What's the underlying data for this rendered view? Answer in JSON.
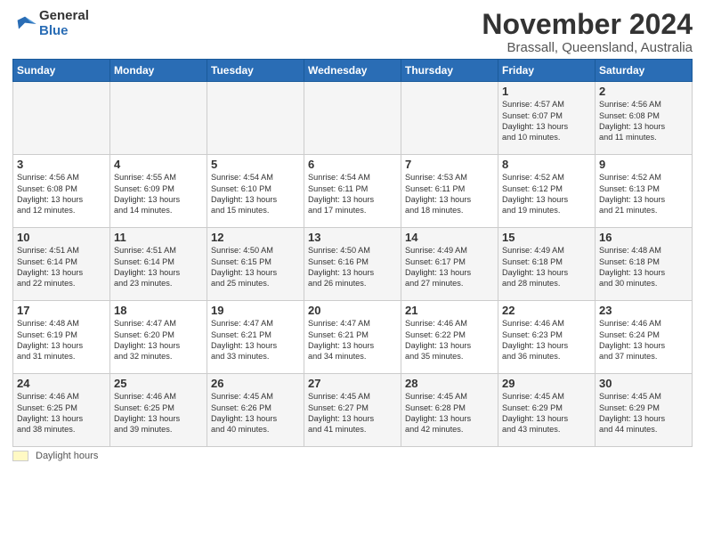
{
  "header": {
    "logo_general": "General",
    "logo_blue": "Blue",
    "month_title": "November 2024",
    "subtitle": "Brassall, Queensland, Australia"
  },
  "legend": {
    "label": "Daylight hours"
  },
  "days_of_week": [
    "Sunday",
    "Monday",
    "Tuesday",
    "Wednesday",
    "Thursday",
    "Friday",
    "Saturday"
  ],
  "weeks": [
    [
      {
        "day": "",
        "info": ""
      },
      {
        "day": "",
        "info": ""
      },
      {
        "day": "",
        "info": ""
      },
      {
        "day": "",
        "info": ""
      },
      {
        "day": "",
        "info": ""
      },
      {
        "day": "1",
        "info": "Sunrise: 4:57 AM\nSunset: 6:07 PM\nDaylight: 13 hours\nand 10 minutes."
      },
      {
        "day": "2",
        "info": "Sunrise: 4:56 AM\nSunset: 6:08 PM\nDaylight: 13 hours\nand 11 minutes."
      }
    ],
    [
      {
        "day": "3",
        "info": "Sunrise: 4:56 AM\nSunset: 6:08 PM\nDaylight: 13 hours\nand 12 minutes."
      },
      {
        "day": "4",
        "info": "Sunrise: 4:55 AM\nSunset: 6:09 PM\nDaylight: 13 hours\nand 14 minutes."
      },
      {
        "day": "5",
        "info": "Sunrise: 4:54 AM\nSunset: 6:10 PM\nDaylight: 13 hours\nand 15 minutes."
      },
      {
        "day": "6",
        "info": "Sunrise: 4:54 AM\nSunset: 6:11 PM\nDaylight: 13 hours\nand 17 minutes."
      },
      {
        "day": "7",
        "info": "Sunrise: 4:53 AM\nSunset: 6:11 PM\nDaylight: 13 hours\nand 18 minutes."
      },
      {
        "day": "8",
        "info": "Sunrise: 4:52 AM\nSunset: 6:12 PM\nDaylight: 13 hours\nand 19 minutes."
      },
      {
        "day": "9",
        "info": "Sunrise: 4:52 AM\nSunset: 6:13 PM\nDaylight: 13 hours\nand 21 minutes."
      }
    ],
    [
      {
        "day": "10",
        "info": "Sunrise: 4:51 AM\nSunset: 6:14 PM\nDaylight: 13 hours\nand 22 minutes."
      },
      {
        "day": "11",
        "info": "Sunrise: 4:51 AM\nSunset: 6:14 PM\nDaylight: 13 hours\nand 23 minutes."
      },
      {
        "day": "12",
        "info": "Sunrise: 4:50 AM\nSunset: 6:15 PM\nDaylight: 13 hours\nand 25 minutes."
      },
      {
        "day": "13",
        "info": "Sunrise: 4:50 AM\nSunset: 6:16 PM\nDaylight: 13 hours\nand 26 minutes."
      },
      {
        "day": "14",
        "info": "Sunrise: 4:49 AM\nSunset: 6:17 PM\nDaylight: 13 hours\nand 27 minutes."
      },
      {
        "day": "15",
        "info": "Sunrise: 4:49 AM\nSunset: 6:18 PM\nDaylight: 13 hours\nand 28 minutes."
      },
      {
        "day": "16",
        "info": "Sunrise: 4:48 AM\nSunset: 6:18 PM\nDaylight: 13 hours\nand 30 minutes."
      }
    ],
    [
      {
        "day": "17",
        "info": "Sunrise: 4:48 AM\nSunset: 6:19 PM\nDaylight: 13 hours\nand 31 minutes."
      },
      {
        "day": "18",
        "info": "Sunrise: 4:47 AM\nSunset: 6:20 PM\nDaylight: 13 hours\nand 32 minutes."
      },
      {
        "day": "19",
        "info": "Sunrise: 4:47 AM\nSunset: 6:21 PM\nDaylight: 13 hours\nand 33 minutes."
      },
      {
        "day": "20",
        "info": "Sunrise: 4:47 AM\nSunset: 6:21 PM\nDaylight: 13 hours\nand 34 minutes."
      },
      {
        "day": "21",
        "info": "Sunrise: 4:46 AM\nSunset: 6:22 PM\nDaylight: 13 hours\nand 35 minutes."
      },
      {
        "day": "22",
        "info": "Sunrise: 4:46 AM\nSunset: 6:23 PM\nDaylight: 13 hours\nand 36 minutes."
      },
      {
        "day": "23",
        "info": "Sunrise: 4:46 AM\nSunset: 6:24 PM\nDaylight: 13 hours\nand 37 minutes."
      }
    ],
    [
      {
        "day": "24",
        "info": "Sunrise: 4:46 AM\nSunset: 6:25 PM\nDaylight: 13 hours\nand 38 minutes."
      },
      {
        "day": "25",
        "info": "Sunrise: 4:46 AM\nSunset: 6:25 PM\nDaylight: 13 hours\nand 39 minutes."
      },
      {
        "day": "26",
        "info": "Sunrise: 4:45 AM\nSunset: 6:26 PM\nDaylight: 13 hours\nand 40 minutes."
      },
      {
        "day": "27",
        "info": "Sunrise: 4:45 AM\nSunset: 6:27 PM\nDaylight: 13 hours\nand 41 minutes."
      },
      {
        "day": "28",
        "info": "Sunrise: 4:45 AM\nSunset: 6:28 PM\nDaylight: 13 hours\nand 42 minutes."
      },
      {
        "day": "29",
        "info": "Sunrise: 4:45 AM\nSunset: 6:29 PM\nDaylight: 13 hours\nand 43 minutes."
      },
      {
        "day": "30",
        "info": "Sunrise: 4:45 AM\nSunset: 6:29 PM\nDaylight: 13 hours\nand 44 minutes."
      }
    ]
  ]
}
